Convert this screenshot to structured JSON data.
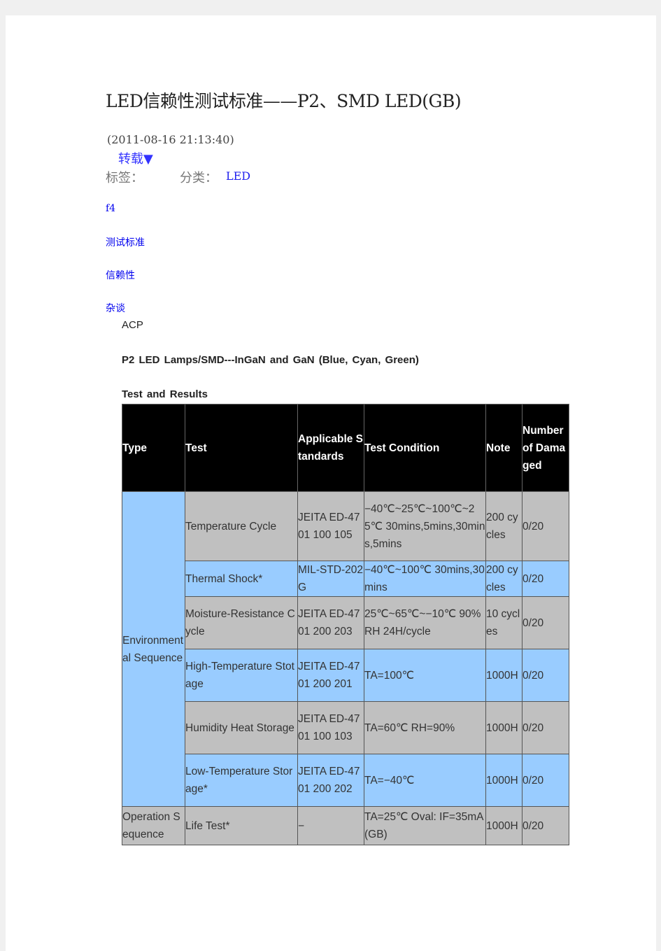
{
  "title": "LED信赖性测试标准——P2、SMD  LED(GB)",
  "date": "(2011-08-16 21:13:40)",
  "repost": "转载▼",
  "tags_label": "标签：",
  "category_label": "分类：",
  "category": "LED",
  "tags": [
    "f4",
    "测试标准",
    "信赖性",
    "杂谈"
  ],
  "acp": "ACP",
  "subtitle": "P2 LED Lamps/SMD---InGaN and GaN (Blue, Cyan, Green)",
  "section": "Test and Results",
  "table": {
    "headers": [
      "Type",
      "Test",
      "Applicable Standards",
      "Test Condition",
      "Note",
      "Number of Damaged"
    ],
    "groups": [
      "Environmental Sequence",
      "Operation Sequence"
    ],
    "rows": [
      {
        "test": "Temperature Cycle",
        "std": "JEITA ED-4701 100 105",
        "cond": "−40℃~25℃~100℃~25℃ 30mins,5mins,30mins,5mins",
        "note": "200 cycles",
        "dmg": "0/20"
      },
      {
        "test": "Thermal Shock*",
        "std": "MIL-STD-202G",
        "cond": "−40℃~100℃ 30mins,30mins",
        "note": "200 cycles",
        "dmg": "0/20"
      },
      {
        "test": "Moisture-Resistance Cycle",
        "std": "JEITA ED-4701 200 203",
        "cond": "25℃~65℃~−10℃ 90%RH 24H/cycle",
        "note": "10 cycles",
        "dmg": "0/20"
      },
      {
        "test": "High-Temperature Stotage",
        "std": "JEITA ED-4701 200 201",
        "cond": "TA=100℃",
        "note": "1000H",
        "dmg": "0/20"
      },
      {
        "test": "Humidity Heat Storage",
        "std": "JEITA ED-4701 100 103",
        "cond": "TA=60℃ RH=90%",
        "note": "1000H",
        "dmg": "0/20"
      },
      {
        "test": "Low-Temperature Storage*",
        "std": "JEITA ED-4701 200 202",
        "cond": "TA=−40℃",
        "note": "1000H",
        "dmg": "0/20"
      },
      {
        "test": "Life Test*",
        "std": "−",
        "cond": "TA=25℃ Oval: IF=35mA(GB)",
        "note": "1000H",
        "dmg": "0/20"
      }
    ]
  }
}
